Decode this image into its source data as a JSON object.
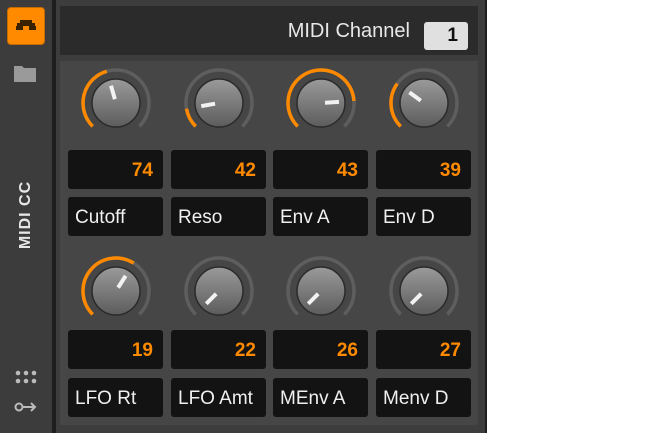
{
  "sidebar": {
    "label": "MIDI CC",
    "icons": [
      "controller-icon",
      "folder-icon",
      "grid-dots-icon",
      "key-mapping-icon"
    ]
  },
  "header": {
    "label": "MIDI Channel",
    "channel": "1"
  },
  "accent": "#ff8a00",
  "controls": [
    {
      "cc": "74",
      "label": "Cutoff",
      "knob": 0.44
    },
    {
      "cc": "42",
      "label": "Reso",
      "knob": 0.13
    },
    {
      "cc": "43",
      "label": "Env A",
      "knob": 0.82
    },
    {
      "cc": "39",
      "label": "Env D",
      "knob": 0.3
    },
    {
      "cc": "19",
      "label": "LFO Rt",
      "knob": 0.62
    },
    {
      "cc": "22",
      "label": "LFO Amt",
      "knob": 0
    },
    {
      "cc": "26",
      "label": "MEnv A",
      "knob": 0
    },
    {
      "cc": "27",
      "label": "Menv D",
      "knob": 0
    }
  ]
}
